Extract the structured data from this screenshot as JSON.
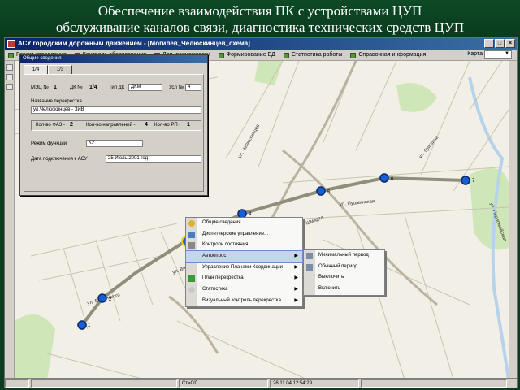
{
  "slide": {
    "title_line1": "Обеспечение взаимодействия ПК с устройствами ЦУП",
    "title_line2": "обслуживание каналов связи, диагностика технических средств ЦУП"
  },
  "window": {
    "title": "АСУ городским дорожным движением - [Могилев_Челюскинцев_схема]",
    "controls": [
      "_",
      "□",
      "×"
    ]
  },
  "menubar": {
    "items": [
      {
        "label": "Режим управления",
        "icon": "mode-icon"
      },
      {
        "label": "Контроль оборудования",
        "icon": "equipment-icon"
      },
      {
        "label": "Доп. возможности",
        "icon": "extras-icon"
      },
      {
        "label": "Формирование БД",
        "icon": "database-icon"
      },
      {
        "label": "Статистика работы",
        "icon": "stats-icon"
      },
      {
        "label": "Справочная информация",
        "icon": "help-icon"
      }
    ],
    "map_label": "Карта",
    "map_value": "▼"
  },
  "map": {
    "street_labels": [
      "ул. Челюскинцев",
      "пр. Шмидта",
      "ул. Белинского",
      "ул. Пушкинская",
      "ул. Гришина",
      "ул. Первомайская",
      "ул. Вишнёвецкая"
    ],
    "crossings": [
      "1",
      "2",
      "3",
      "4",
      "5",
      "6",
      "7"
    ],
    "colors": {
      "background": "#f2efe6",
      "route": "#8e8e7a",
      "node_fill": "#1560d8",
      "node_ring": "#0a2a66"
    }
  },
  "info_panel": {
    "title": "Общие сведения",
    "tabs": [
      "1/4",
      "1/3"
    ],
    "mdc_label": "МЭЦ №",
    "mdc_value": "1",
    "dk_label": "ДК №",
    "dk_value": "1/4",
    "dk_type_label": "Тип ДК",
    "dk_type_value": "ДКМ",
    "usl_label": "Усл №",
    "usl_value": "4",
    "intersection_label": "Название перекрестка",
    "intersection_value": "ул.Челюскинцев - ЗИВ",
    "phases_label": "Кол-во ФАЗ -",
    "phases_value": "2",
    "directions_label": "Кол-во направлений -",
    "directions_value": "4",
    "rp_label": "Кол-во РП -",
    "rp_value": "1",
    "mode_label": "Режим функции",
    "mode_value": "КУ",
    "date_label": "Дата подключения к АСУ",
    "date_value": "25 Июль 2001 год"
  },
  "context_menu": {
    "items": [
      {
        "label": "Общие сведения...",
        "icon": "info-icon",
        "submenu": false,
        "selected": false
      },
      {
        "label": "Диспетчерские управление...",
        "icon": "dispatch-icon",
        "submenu": false,
        "selected": false
      },
      {
        "label": "Контроль состояния",
        "icon": "tools-icon",
        "submenu": false,
        "selected": false
      },
      {
        "label": "Автоопрос",
        "icon": "autopoll-icon",
        "submenu": true,
        "selected": true
      },
      {
        "label": "Управление Планами Координации",
        "icon": "plans-icon",
        "submenu": true,
        "selected": false
      },
      {
        "label": "План перекрестка",
        "icon": "plan-icon",
        "submenu": true,
        "selected": false
      },
      {
        "label": "Статистика",
        "icon": "statistics-icon",
        "submenu": true,
        "selected": false
      },
      {
        "label": "Визуальный контроль перекрестка",
        "icon": "visual-icon",
        "submenu": true,
        "selected": false
      }
    ],
    "arrow": "▶"
  },
  "submenu": {
    "items": [
      {
        "label": "Минимальный период",
        "icon": "min-period-icon"
      },
      {
        "label": "Обычный период",
        "icon": "normal-period-icon"
      },
      {
        "label": "Выключить",
        "icon": "off-icon"
      },
      {
        "label": "Включить",
        "icon": "on-icon"
      }
    ]
  },
  "statusbar": {
    "cells": [
      "",
      "",
      "Ст=0/0",
      "26.11.04 12:54:29",
      ""
    ]
  }
}
